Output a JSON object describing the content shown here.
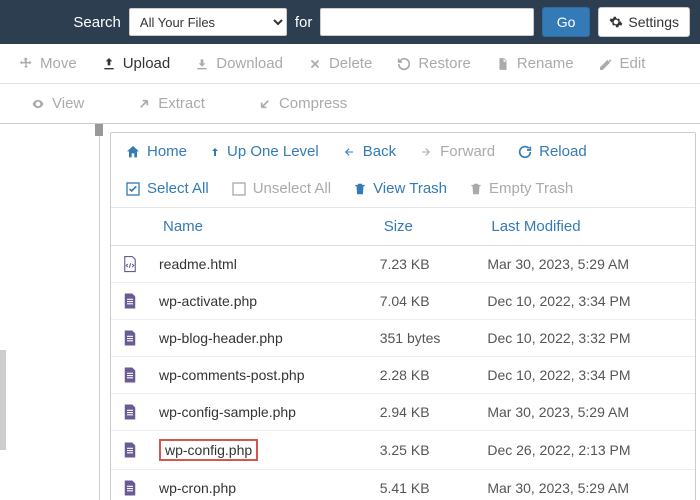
{
  "search": {
    "label": "Search",
    "select_value": "All Your Files",
    "for_label": "for",
    "input_value": "",
    "go_label": "Go",
    "settings_label": "Settings"
  },
  "toolbar1": {
    "move": "Move",
    "upload": "Upload",
    "download": "Download",
    "delete": "Delete",
    "restore": "Restore",
    "rename": "Rename",
    "edit": "Edit"
  },
  "toolbar2": {
    "view": "View",
    "extract": "Extract",
    "compress": "Compress"
  },
  "nav1": {
    "home": "Home",
    "up": "Up One Level",
    "back": "Back",
    "forward": "Forward",
    "reload": "Reload"
  },
  "nav2": {
    "select_all": "Select All",
    "unselect_all": "Unselect All",
    "view_trash": "View Trash",
    "empty_trash": "Empty Trash"
  },
  "columns": {
    "name": "Name",
    "size": "Size",
    "modified": "Last Modified"
  },
  "files": [
    {
      "name": "readme.html",
      "size": "7.23 KB",
      "modified": "Mar 30, 2023, 5:29 AM",
      "icon": "code"
    },
    {
      "name": "wp-activate.php",
      "size": "7.04 KB",
      "modified": "Dec 10, 2022, 3:34 PM",
      "icon": "file"
    },
    {
      "name": "wp-blog-header.php",
      "size": "351 bytes",
      "modified": "Dec 10, 2022, 3:32 PM",
      "icon": "file"
    },
    {
      "name": "wp-comments-post.php",
      "size": "2.28 KB",
      "modified": "Dec 10, 2022, 3:34 PM",
      "icon": "file"
    },
    {
      "name": "wp-config-sample.php",
      "size": "2.94 KB",
      "modified": "Mar 30, 2023, 5:29 AM",
      "icon": "file"
    },
    {
      "name": "wp-config.php",
      "size": "3.25 KB",
      "modified": "Dec 26, 2022, 2:13 PM",
      "icon": "file",
      "highlight": true
    },
    {
      "name": "wp-cron.php",
      "size": "5.41 KB",
      "modified": "Mar 30, 2023, 5:29 AM",
      "icon": "file"
    }
  ]
}
